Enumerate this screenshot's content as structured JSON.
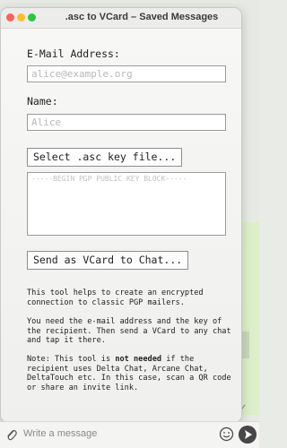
{
  "window": {
    "title": ".asc to VCard – Saved Messages"
  },
  "form": {
    "email_label": "E-Mail Address:",
    "email_placeholder": "alice@example.org",
    "email_value": "",
    "name_label": "Name:",
    "name_placeholder": "Alice",
    "name_value": "",
    "select_button": "Select .asc key file...",
    "key_placeholder": "-----BEGIN PGP PUBLIC KEY BLOCK-----",
    "send_button": "Send as VCard to Chat..."
  },
  "help": {
    "p1": "This tool helps to create an encrypted connection to classic PGP mailers.",
    "p2": "You need the e-mail address and the key of the recipient. Then send a VCard to any chat and tap it there.",
    "p3_before": "Note: This tool is ",
    "p3_bold": "not needed",
    "p3_after": " if the recipient uses Delta Chat, Arcane Chat, DeltaTouch etc. In this case, scan a QR code or share an invite link."
  },
  "composer": {
    "placeholder": "Write a message"
  },
  "icons": {
    "attach": "paperclip-icon",
    "emoji": "emoji-icon",
    "send": "send-icon",
    "status": "checkmark-icon"
  }
}
